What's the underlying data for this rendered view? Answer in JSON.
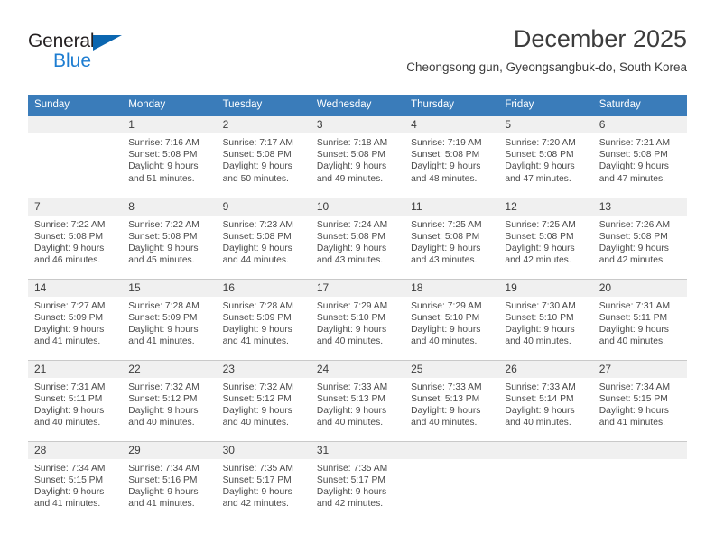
{
  "brand": {
    "word_one": "General",
    "word_two": "Blue",
    "triangle_color": "#0b66b0",
    "blue_color": "#1d7dd1"
  },
  "header": {
    "title": "December 2025",
    "subtitle": "Cheongsong gun, Gyeongsangbuk-do, South Korea"
  },
  "theme": {
    "header_row_bg": "#3a7cba",
    "date_band_bg": "#f0f0f0",
    "text_color": "#3c3c3c",
    "row_divider": "#c9c9c9"
  },
  "columns": [
    "Sunday",
    "Monday",
    "Tuesday",
    "Wednesday",
    "Thursday",
    "Friday",
    "Saturday"
  ],
  "weeks": [
    [
      {
        "day": "",
        "sunrise": "",
        "sunset": "",
        "daylight_line1": "",
        "daylight_line2": ""
      },
      {
        "day": "1",
        "sunrise": "Sunrise: 7:16 AM",
        "sunset": "Sunset: 5:08 PM",
        "daylight_line1": "Daylight: 9 hours",
        "daylight_line2": "and 51 minutes."
      },
      {
        "day": "2",
        "sunrise": "Sunrise: 7:17 AM",
        "sunset": "Sunset: 5:08 PM",
        "daylight_line1": "Daylight: 9 hours",
        "daylight_line2": "and 50 minutes."
      },
      {
        "day": "3",
        "sunrise": "Sunrise: 7:18 AM",
        "sunset": "Sunset: 5:08 PM",
        "daylight_line1": "Daylight: 9 hours",
        "daylight_line2": "and 49 minutes."
      },
      {
        "day": "4",
        "sunrise": "Sunrise: 7:19 AM",
        "sunset": "Sunset: 5:08 PM",
        "daylight_line1": "Daylight: 9 hours",
        "daylight_line2": "and 48 minutes."
      },
      {
        "day": "5",
        "sunrise": "Sunrise: 7:20 AM",
        "sunset": "Sunset: 5:08 PM",
        "daylight_line1": "Daylight: 9 hours",
        "daylight_line2": "and 47 minutes."
      },
      {
        "day": "6",
        "sunrise": "Sunrise: 7:21 AM",
        "sunset": "Sunset: 5:08 PM",
        "daylight_line1": "Daylight: 9 hours",
        "daylight_line2": "and 47 minutes."
      }
    ],
    [
      {
        "day": "7",
        "sunrise": "Sunrise: 7:22 AM",
        "sunset": "Sunset: 5:08 PM",
        "daylight_line1": "Daylight: 9 hours",
        "daylight_line2": "and 46 minutes."
      },
      {
        "day": "8",
        "sunrise": "Sunrise: 7:22 AM",
        "sunset": "Sunset: 5:08 PM",
        "daylight_line1": "Daylight: 9 hours",
        "daylight_line2": "and 45 minutes."
      },
      {
        "day": "9",
        "sunrise": "Sunrise: 7:23 AM",
        "sunset": "Sunset: 5:08 PM",
        "daylight_line1": "Daylight: 9 hours",
        "daylight_line2": "and 44 minutes."
      },
      {
        "day": "10",
        "sunrise": "Sunrise: 7:24 AM",
        "sunset": "Sunset: 5:08 PM",
        "daylight_line1": "Daylight: 9 hours",
        "daylight_line2": "and 43 minutes."
      },
      {
        "day": "11",
        "sunrise": "Sunrise: 7:25 AM",
        "sunset": "Sunset: 5:08 PM",
        "daylight_line1": "Daylight: 9 hours",
        "daylight_line2": "and 43 minutes."
      },
      {
        "day": "12",
        "sunrise": "Sunrise: 7:25 AM",
        "sunset": "Sunset: 5:08 PM",
        "daylight_line1": "Daylight: 9 hours",
        "daylight_line2": "and 42 minutes."
      },
      {
        "day": "13",
        "sunrise": "Sunrise: 7:26 AM",
        "sunset": "Sunset: 5:08 PM",
        "daylight_line1": "Daylight: 9 hours",
        "daylight_line2": "and 42 minutes."
      }
    ],
    [
      {
        "day": "14",
        "sunrise": "Sunrise: 7:27 AM",
        "sunset": "Sunset: 5:09 PM",
        "daylight_line1": "Daylight: 9 hours",
        "daylight_line2": "and 41 minutes."
      },
      {
        "day": "15",
        "sunrise": "Sunrise: 7:28 AM",
        "sunset": "Sunset: 5:09 PM",
        "daylight_line1": "Daylight: 9 hours",
        "daylight_line2": "and 41 minutes."
      },
      {
        "day": "16",
        "sunrise": "Sunrise: 7:28 AM",
        "sunset": "Sunset: 5:09 PM",
        "daylight_line1": "Daylight: 9 hours",
        "daylight_line2": "and 41 minutes."
      },
      {
        "day": "17",
        "sunrise": "Sunrise: 7:29 AM",
        "sunset": "Sunset: 5:10 PM",
        "daylight_line1": "Daylight: 9 hours",
        "daylight_line2": "and 40 minutes."
      },
      {
        "day": "18",
        "sunrise": "Sunrise: 7:29 AM",
        "sunset": "Sunset: 5:10 PM",
        "daylight_line1": "Daylight: 9 hours",
        "daylight_line2": "and 40 minutes."
      },
      {
        "day": "19",
        "sunrise": "Sunrise: 7:30 AM",
        "sunset": "Sunset: 5:10 PM",
        "daylight_line1": "Daylight: 9 hours",
        "daylight_line2": "and 40 minutes."
      },
      {
        "day": "20",
        "sunrise": "Sunrise: 7:31 AM",
        "sunset": "Sunset: 5:11 PM",
        "daylight_line1": "Daylight: 9 hours",
        "daylight_line2": "and 40 minutes."
      }
    ],
    [
      {
        "day": "21",
        "sunrise": "Sunrise: 7:31 AM",
        "sunset": "Sunset: 5:11 PM",
        "daylight_line1": "Daylight: 9 hours",
        "daylight_line2": "and 40 minutes."
      },
      {
        "day": "22",
        "sunrise": "Sunrise: 7:32 AM",
        "sunset": "Sunset: 5:12 PM",
        "daylight_line1": "Daylight: 9 hours",
        "daylight_line2": "and 40 minutes."
      },
      {
        "day": "23",
        "sunrise": "Sunrise: 7:32 AM",
        "sunset": "Sunset: 5:12 PM",
        "daylight_line1": "Daylight: 9 hours",
        "daylight_line2": "and 40 minutes."
      },
      {
        "day": "24",
        "sunrise": "Sunrise: 7:33 AM",
        "sunset": "Sunset: 5:13 PM",
        "daylight_line1": "Daylight: 9 hours",
        "daylight_line2": "and 40 minutes."
      },
      {
        "day": "25",
        "sunrise": "Sunrise: 7:33 AM",
        "sunset": "Sunset: 5:13 PM",
        "daylight_line1": "Daylight: 9 hours",
        "daylight_line2": "and 40 minutes."
      },
      {
        "day": "26",
        "sunrise": "Sunrise: 7:33 AM",
        "sunset": "Sunset: 5:14 PM",
        "daylight_line1": "Daylight: 9 hours",
        "daylight_line2": "and 40 minutes."
      },
      {
        "day": "27",
        "sunrise": "Sunrise: 7:34 AM",
        "sunset": "Sunset: 5:15 PM",
        "daylight_line1": "Daylight: 9 hours",
        "daylight_line2": "and 41 minutes."
      }
    ],
    [
      {
        "day": "28",
        "sunrise": "Sunrise: 7:34 AM",
        "sunset": "Sunset: 5:15 PM",
        "daylight_line1": "Daylight: 9 hours",
        "daylight_line2": "and 41 minutes."
      },
      {
        "day": "29",
        "sunrise": "Sunrise: 7:34 AM",
        "sunset": "Sunset: 5:16 PM",
        "daylight_line1": "Daylight: 9 hours",
        "daylight_line2": "and 41 minutes."
      },
      {
        "day": "30",
        "sunrise": "Sunrise: 7:35 AM",
        "sunset": "Sunset: 5:17 PM",
        "daylight_line1": "Daylight: 9 hours",
        "daylight_line2": "and 42 minutes."
      },
      {
        "day": "31",
        "sunrise": "Sunrise: 7:35 AM",
        "sunset": "Sunset: 5:17 PM",
        "daylight_line1": "Daylight: 9 hours",
        "daylight_line2": "and 42 minutes."
      },
      {
        "day": "",
        "sunrise": "",
        "sunset": "",
        "daylight_line1": "",
        "daylight_line2": ""
      },
      {
        "day": "",
        "sunrise": "",
        "sunset": "",
        "daylight_line1": "",
        "daylight_line2": ""
      },
      {
        "day": "",
        "sunrise": "",
        "sunset": "",
        "daylight_line1": "",
        "daylight_line2": ""
      }
    ]
  ]
}
